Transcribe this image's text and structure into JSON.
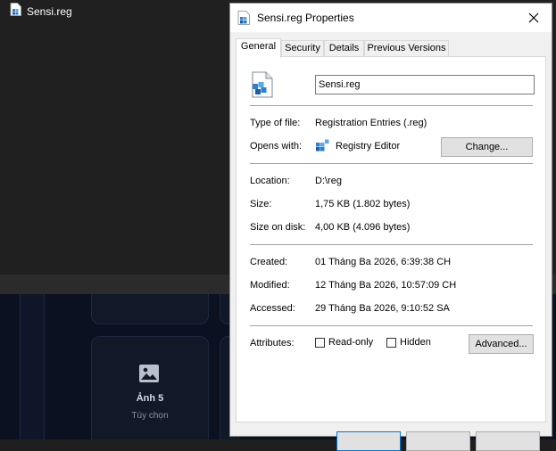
{
  "background": {
    "file_title": "Sensi.reg",
    "card": {
      "title": "Ảnh 5",
      "subtitle": "Tùy chọn"
    }
  },
  "dialog": {
    "title": "Sensi.reg Properties",
    "tabs": [
      "General",
      "Security",
      "Details",
      "Previous Versions"
    ],
    "active_tab": "General",
    "file_name": "Sensi.reg",
    "type_label": "Type of file:",
    "type_value": "Registration Entries (.reg)",
    "opens_label": "Opens with:",
    "opens_value": "Registry Editor",
    "change_label": "Change...",
    "location_label": "Location:",
    "location_value": "D:\\reg",
    "size_label": "Size:",
    "size_value": "1,75 KB (1.802 bytes)",
    "size_disk_label": "Size on disk:",
    "size_disk_value": "4,00 KB (4.096 bytes)",
    "created_label": "Created:",
    "created_value": "01 Tháng Ba 2026, 6:39:38 CH",
    "modified_label": "Modified:",
    "modified_value": "12 Tháng Ba 2026, 10:57:09 CH",
    "accessed_label": "Accessed:",
    "accessed_value": "29 Tháng Ba 2026, 9:10:52 SA",
    "attributes_label": "Attributes:",
    "readonly_label": "Read-only",
    "hidden_label": "Hidden",
    "advanced_label": "Advanced...",
    "readonly_checked": false,
    "hidden_checked": false
  },
  "colors": {
    "accent": "#0078d7",
    "dialog_bg": "#f0f0f0",
    "dark_bg": "#202020"
  }
}
